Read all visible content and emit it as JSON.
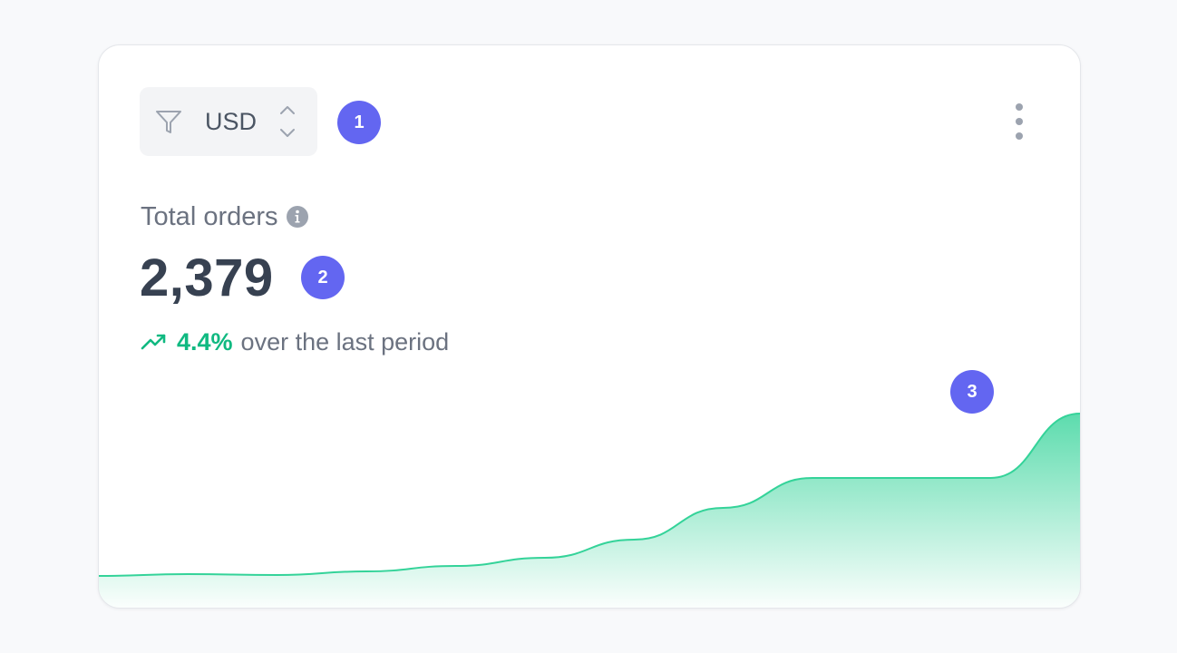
{
  "currency_select": {
    "value": "USD",
    "filter_icon": "filter-icon",
    "stepper_icon": "chevron-up-down-icon"
  },
  "badges": {
    "one": "1",
    "two": "2",
    "three": "3"
  },
  "menu": {
    "icon": "more-vertical-icon"
  },
  "metric": {
    "label": "Total orders",
    "info_icon": "info-icon",
    "value": "2,379"
  },
  "trend": {
    "icon": "trending-up-icon",
    "percent": "4.4%",
    "text": "over the last period"
  },
  "colors": {
    "accent": "#6366f1",
    "positive": "#10b981",
    "chart_line": "#34d399",
    "text_primary": "#374151",
    "text_secondary": "#6b7280"
  },
  "chart_data": {
    "type": "area",
    "x": [
      0,
      1,
      2,
      3,
      4,
      5,
      6,
      7,
      8,
      9,
      10,
      11
    ],
    "values": [
      35,
      37,
      36,
      40,
      46,
      55,
      75,
      110,
      143,
      143,
      143,
      214
    ],
    "ylim": [
      0,
      250
    ],
    "grid": false,
    "title": "",
    "xlabel": "",
    "ylabel": ""
  }
}
